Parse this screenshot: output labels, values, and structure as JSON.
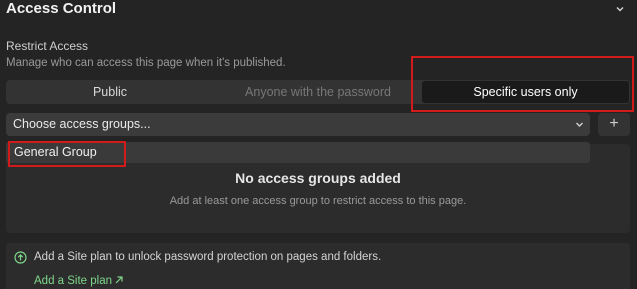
{
  "header": {
    "title": "Access Control",
    "collapse_icon": "chevron-down-icon"
  },
  "restrict": {
    "label": "Restrict Access",
    "description": "Manage who can access this page when it's published.",
    "options": [
      {
        "label": "Public",
        "selected": false
      },
      {
        "label": "Anyone with the password",
        "selected": false,
        "disabled": true
      },
      {
        "label": "Specific users only",
        "selected": true
      }
    ]
  },
  "groups": {
    "placeholder": "Choose access groups...",
    "add_icon": "plus-icon",
    "dropdown_items": [
      "General Group"
    ],
    "empty_title": "No access groups added",
    "empty_description": "Add at least one access group to restrict access to this page."
  },
  "plan_notice": {
    "text": "Add a Site plan to unlock password protection on pages and folders.",
    "link": "Add a Site plan",
    "icon": "upgrade-icon",
    "link_icon": "external-arrow-icon"
  },
  "colors": {
    "highlight": "#d11a1a",
    "link": "#7ed68a",
    "background": "#242424"
  }
}
